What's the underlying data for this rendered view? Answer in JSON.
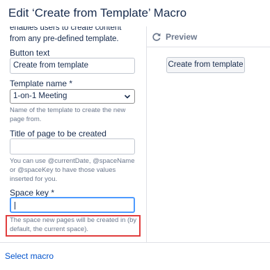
{
  "dialog": {
    "title": "Edit ‘Create from Template’ Macro"
  },
  "form": {
    "intro_text": "enables users to create content from any pre-defined template.",
    "button_text_label": "Button text",
    "button_text_value": "Create from template",
    "template_name_label": "Template name *",
    "template_name_value": "1-on-1 Meeting",
    "template_name_help": "Name of the template to create the new page from.",
    "page_title_label": "Title of page to be created",
    "page_title_value": "",
    "page_title_help": "You can use @currentDate, @spaceName or @spaceKey to have those values inserted for you.",
    "space_key_label": "Space key *",
    "space_key_value": "",
    "space_key_help": "The space new pages will be created in (by default, the current space)."
  },
  "preview": {
    "label": "Preview",
    "button_label": "Create from template",
    "icon": "refresh-icon"
  },
  "footer": {
    "select_macro_label": "Select macro"
  },
  "colors": {
    "link": "#0052cc",
    "focus_ring": "#4c9aff",
    "highlight_box": "#e03c3c",
    "help_text": "#6b778c"
  }
}
